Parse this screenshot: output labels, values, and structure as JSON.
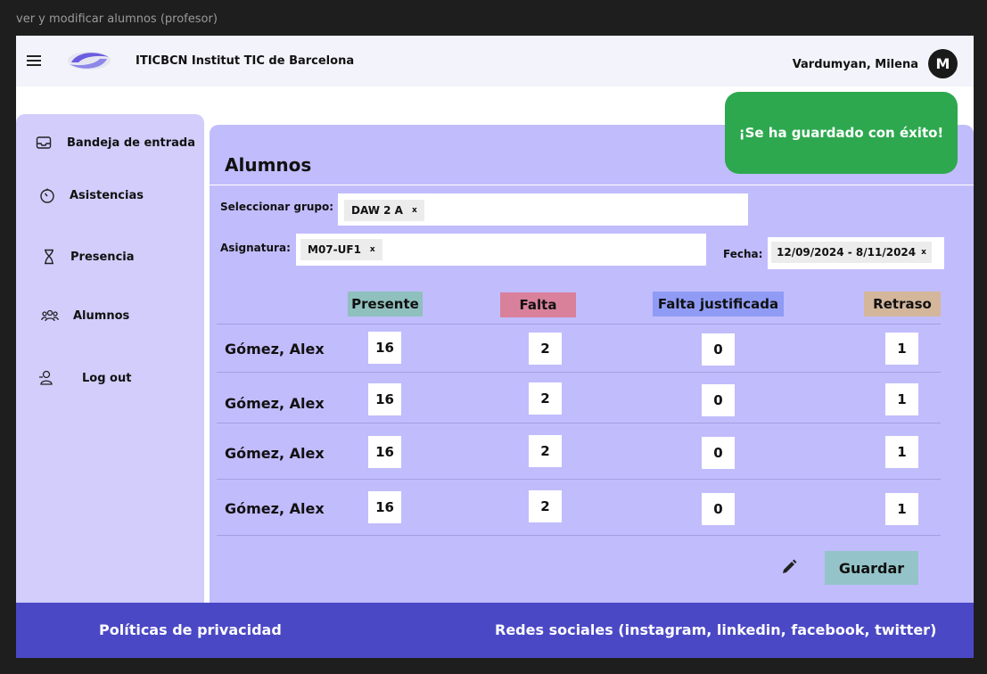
{
  "frame_label": "ver y modificar alumnos (profesor)",
  "header": {
    "org_name": "ITICBCN Institut TIC de Barcelona",
    "user_name": "Vardumyan, Milena",
    "avatar_initial": "M"
  },
  "sidebar": {
    "items": [
      {
        "label": "Bandeja de entrada",
        "icon": "inbox-icon"
      },
      {
        "label": "Asistencias",
        "icon": "timer-icon"
      },
      {
        "label": "Presencia",
        "icon": "hourglass-icon"
      },
      {
        "label": "Alumnos",
        "icon": "users-icon"
      },
      {
        "label": "Log out",
        "icon": "user-logout-icon"
      }
    ]
  },
  "main": {
    "title": "Alumnos",
    "group_label": "Seleccionar grupo:",
    "group_value": "DAW 2 A",
    "subject_label": "Asignatura:",
    "subject_value": "M07-UF1",
    "date_label": "Fecha:",
    "date_value": "12/09/2024 - 8/11/2024",
    "chip_remove": "x",
    "columns": [
      {
        "label": "Presente",
        "color": "#8fc0be"
      },
      {
        "label": "Falta",
        "color": "#d9819b"
      },
      {
        "label": "Falta justificada",
        "color": "#8f9bf5"
      },
      {
        "label": "Retraso",
        "color": "#d4b69b"
      }
    ],
    "rows": [
      {
        "name": "Gómez, Alex",
        "presente": "16",
        "falta": "2",
        "justificada": "0",
        "retraso": "1"
      },
      {
        "name": "Gómez, Alex",
        "presente": "16",
        "falta": "2",
        "justificada": "0",
        "retraso": "1"
      },
      {
        "name": "Gómez, Alex",
        "presente": "16",
        "falta": "2",
        "justificada": "0",
        "retraso": "1"
      },
      {
        "name": "Gómez, Alex",
        "presente": "16",
        "falta": "2",
        "justificada": "0",
        "retraso": "1"
      }
    ],
    "save_label": "Guardar"
  },
  "toast": {
    "message": "¡Se ha guardado con éxito!",
    "color": "#2ea84f"
  },
  "footer": {
    "privacy": "Políticas de privacidad",
    "social": "Redes sociales (instagram, linkedin, facebook, twitter)"
  }
}
